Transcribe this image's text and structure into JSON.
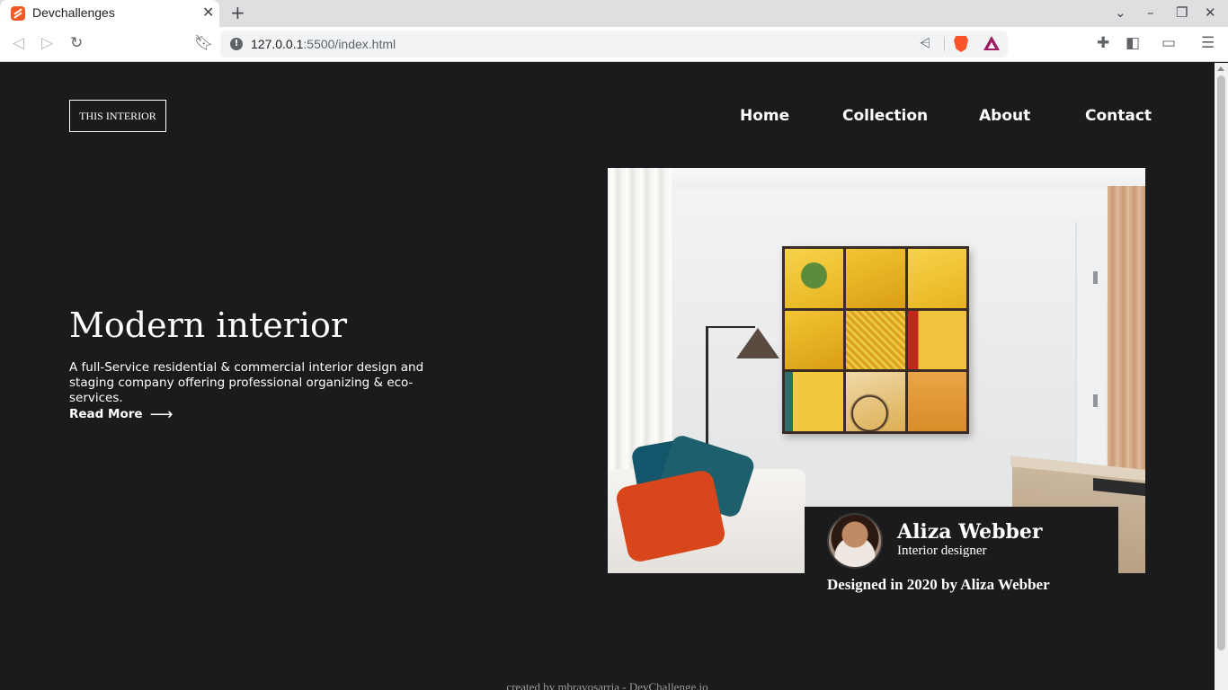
{
  "browser": {
    "tab_title": "Devchallenges",
    "tab_close": "✕",
    "new_tab": "+",
    "url_host": "127.0.0.1",
    "url_path": ":5500/index.html",
    "icons": {
      "back": "back-arrow-icon",
      "forward": "forward-arrow-icon",
      "reload": "reload-icon",
      "bookmark": "bookmark-icon",
      "info": "info-icon",
      "share": "share-icon",
      "brave": "brave-shield-icon",
      "rewards": "brave-rewards-icon",
      "extensions": "puzzle-icon",
      "sidebar": "sidebar-icon",
      "wallet": "wallet-icon",
      "menu": "hamburger-menu-icon"
    }
  },
  "page": {
    "logo": "THIS INTERIOR",
    "nav": [
      "Home",
      "Collection",
      "About",
      "Contact"
    ],
    "hero": {
      "title": "Modern interior",
      "description": "A full-Service residential & commercial interior design and staging company offering professional organizing & eco-services.",
      "read_more": "Read More",
      "read_more_arrow": "⟶"
    },
    "designer": {
      "name": "Aliza Webber",
      "role": "Interior designer",
      "credit": "Designed in 2020 by Aliza Webber"
    },
    "footer": "created by mbravosarria - DevChallenge.io"
  },
  "colors": {
    "page_background": "#1b1b1e",
    "text": "#ffffff",
    "tab_favicon": "#f15a24"
  }
}
